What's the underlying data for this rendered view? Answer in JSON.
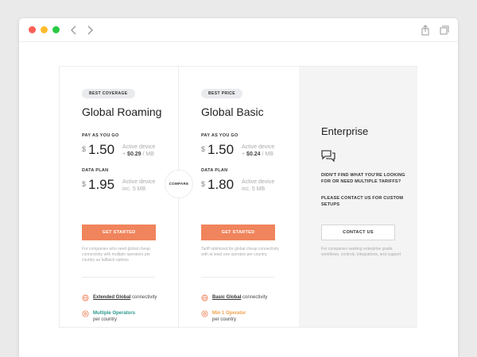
{
  "colors": {
    "accent": "#f0845c",
    "teal": "#2a9a8c",
    "orange": "#f0a04b"
  },
  "browser": {
    "back_icon": "chevron-left-icon",
    "forward_icon": "chevron-right-icon",
    "share_icon": "share-icon",
    "tabs_icon": "tabs-icon"
  },
  "compare_label": "COMPARE",
  "plans": [
    {
      "badge": "BEST COVERAGE",
      "title": "Global Roaming",
      "payg_label": "PAY AS YOU GO",
      "payg_currency": "$",
      "payg_price": "1.50",
      "payg_note_line1": "Active device",
      "payg_note_plus": "+",
      "payg_note_value": "$0.29",
      "payg_note_unit": "/ MB",
      "data_label": "DATA PLAN",
      "data_currency": "$",
      "data_price": "1.95",
      "data_note_line1": "Active device",
      "data_note_line2": "inc. 5 MB",
      "cta": "GET STARTED",
      "description": "For companies who need global cheap connectivity with multiple operators per country as fallback options",
      "features": [
        {
          "icon": "globe-icon",
          "strong": "Extended Global",
          "rest": " connectivity"
        },
        {
          "icon": "operator-icon",
          "strong": "Multiple Operators",
          "rest": "per country"
        }
      ]
    },
    {
      "badge": "BEST PRICE",
      "title": "Global Basic",
      "payg_label": "PAY AS YOU GO",
      "payg_currency": "$",
      "payg_price": "1.50",
      "payg_note_line1": "Active device",
      "payg_note_plus": "+",
      "payg_note_value": "$0.24",
      "payg_note_unit": "/ MB",
      "data_label": "DATA PLAN",
      "data_currency": "$",
      "data_price": "1.80",
      "data_note_line1": "Active device",
      "data_note_line2": "inc. 5 MB",
      "cta": "GET STARTED",
      "description": "Tariff optimized for global cheap connectivity with at least one operator per country.",
      "features": [
        {
          "icon": "globe-icon",
          "strong": "Basic Global",
          "rest": " connectivity"
        },
        {
          "icon": "operator-icon",
          "strong": "Min 1 Operator",
          "rest": "per country"
        }
      ]
    }
  ],
  "enterprise": {
    "title": "Enterprise",
    "icon": "chat-bubbles-icon",
    "question": "DIDN'T FIND WHAT YOU'RE LOOKING FOR OR NEED MULTIPLE TARIFFS?",
    "contact_line": "PLEASE CONTACT US FOR CUSTOM SETUPS",
    "cta": "CONTACT US",
    "description": "For companies seeking enterprise grade workflows, controls, integrations, and support"
  }
}
